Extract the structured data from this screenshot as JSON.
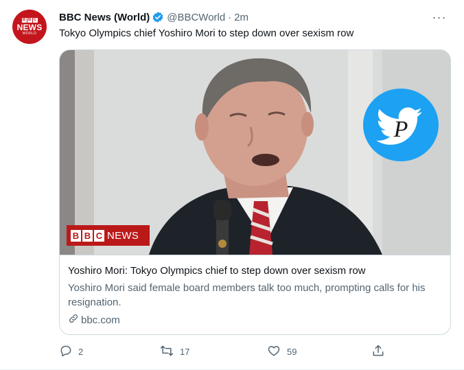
{
  "tweet": {
    "author_name": "BBC News (World)",
    "handle": "@BBCWorld",
    "separator": "·",
    "time": "2m",
    "more_glyph": "···",
    "text": "Tokyo Olympics chief Yoshiro Mori to step down over sexism row",
    "avatar": {
      "blocks": [
        "B",
        "B",
        "C"
      ],
      "line1": "NEWS",
      "line2": "WORLD"
    }
  },
  "card": {
    "image_logo": {
      "blocks": [
        "B",
        "B",
        "C"
      ],
      "word": "NEWS"
    },
    "title": "Yoshiro Mori: Tokyo Olympics chief to step down over sexism row",
    "description": "Yoshiro Mori said female board members talk too much, prompting calls for his resignation.",
    "domain": "bbc.com"
  },
  "actions": {
    "replies": "2",
    "retweets": "17",
    "likes": "59"
  },
  "colors": {
    "brand_red": "#bb1919",
    "verified_blue": "#1d9bf0",
    "twitter_blue": "#1da1f2",
    "muted_text": "#536471",
    "border": "#cfd9de"
  },
  "icons": [
    "verified-badge-icon",
    "more-options-icon",
    "link-icon",
    "reply-icon",
    "retweet-icon",
    "like-icon",
    "share-icon",
    "twitter-bird-icon"
  ]
}
